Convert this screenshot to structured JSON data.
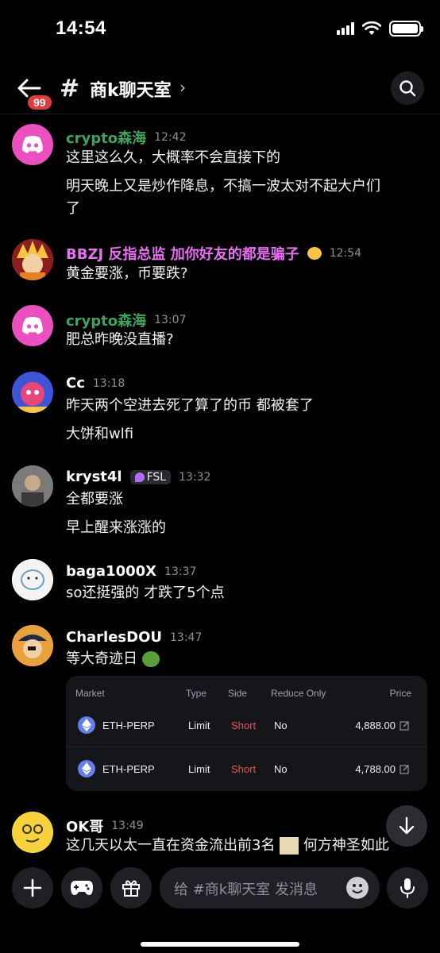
{
  "status": {
    "time": "14:54"
  },
  "header": {
    "back_badge": "99",
    "hash": "#",
    "channel_name": "商k聊天室",
    "chevron": "›"
  },
  "messages": [
    {
      "user": "crypto森海",
      "time": "12:42",
      "name_color": "#3ba55c",
      "lines": [
        "这里这么久，大概率不会直接下的",
        "明天晚上又是炒作降息，不搞一波太对不起大户们",
        "了"
      ]
    },
    {
      "user": "BBZJ 反指总监  加你好友的都是骗子",
      "time": "12:54",
      "name_color": "#e86ef2",
      "lines": [
        "黄金要涨，币要跌?"
      ]
    },
    {
      "user": "crypto森海",
      "time": "13:07",
      "name_color": "#3ba55c",
      "lines": [
        "肥总昨晚没直播?"
      ]
    },
    {
      "user": "Cc",
      "time": "13:18",
      "name_color": "#ffffff",
      "lines": [
        "昨天两个空进去死了算了的币 都被套了",
        "大饼和wlfi"
      ]
    },
    {
      "user": "kryst4l",
      "time": "13:32",
      "name_color": "#ffffff",
      "role_tag": "FSL",
      "lines": [
        "全都要涨",
        "早上醒来涨涨的"
      ]
    },
    {
      "user": "baga1000X",
      "time": "13:37",
      "name_color": "#ffffff",
      "lines": [
        "so还挺强的 才跌了5个点"
      ]
    },
    {
      "user": "CharlesDOU",
      "time": "13:47",
      "name_color": "#ffffff",
      "lines": [
        "等大奇迹日"
      ]
    },
    {
      "user": "OK哥",
      "time": "13:49",
      "name_color": "#ffffff",
      "lines": [
        "这几天以太一直在资金流出前3名",
        "何方神圣如此"
      ]
    }
  ],
  "order_card": {
    "headers": [
      "Market",
      "Type",
      "Side",
      "Reduce Only",
      "Price"
    ],
    "rows": [
      {
        "market": "ETH-PERP",
        "type": "Limit",
        "side": "Short",
        "reduce_only": "No",
        "price": "4,888.00"
      },
      {
        "market": "ETH-PERP",
        "type": "Limit",
        "side": "Short",
        "reduce_only": "No",
        "price": "4,788.00"
      }
    ]
  },
  "composer": {
    "placeholder": "给 #商k聊天室 发消息"
  },
  "colors": {
    "background": "#000000",
    "short": "#f0504f",
    "discord_avatar": "#ec4fbf"
  }
}
